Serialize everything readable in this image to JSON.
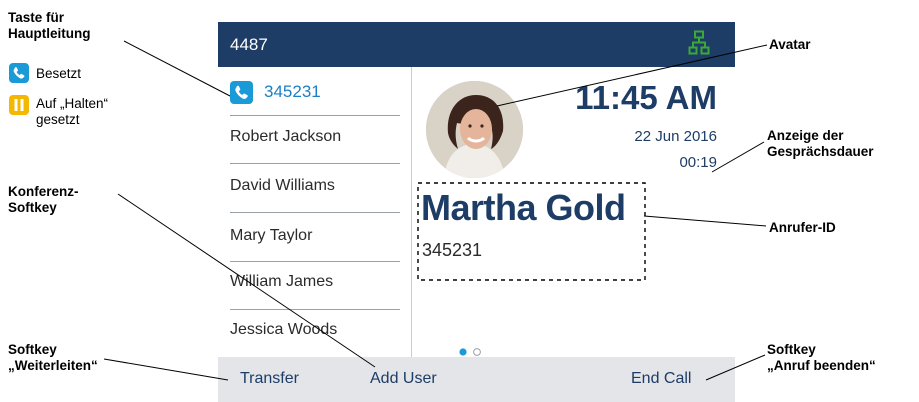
{
  "phone": {
    "extension": "4487",
    "line_key_label": "345231",
    "contacts": [
      "Robert Jackson",
      "David Williams",
      "Mary Taylor",
      "William James",
      "Jessica Woods"
    ],
    "time": "11:45 AM",
    "date": "22 Jun 2016",
    "call_duration": "00:19",
    "caller_name": "Martha Gold",
    "caller_number": "345231",
    "softkeys": {
      "transfer": "Transfer",
      "add_user": "Add User",
      "end_call": "End Call"
    },
    "pagination": {
      "pages": 2,
      "current": 1
    }
  },
  "annotations": {
    "line_key_1": "Taste für",
    "line_key_2": "Hauptleitung",
    "legend_busy": "Besetzt",
    "legend_hold_1": "Auf „Halten“",
    "legend_hold_2": "gesetzt",
    "conf_1": "Konferenz-",
    "conf_2": "Softkey",
    "fwd_1": "Softkey",
    "fwd_2": "„Weiterleiten“",
    "avatar": "Avatar",
    "dur_1": "Anzeige der",
    "dur_2": "Gesprächsdauer",
    "callerid": "Anrufer-ID",
    "end_1": "Softkey",
    "end_2": "„Anruf beenden“"
  },
  "colors": {
    "header_bg": "#1d3c66",
    "accent_blue": "#1a9bd8",
    "hold_yellow": "#f5b800",
    "network_green": "#3aa935",
    "softkey_bar": "#e3e5e8"
  },
  "icons": {
    "network": "network-icon",
    "line_key": "phone-handset-icon",
    "busy": "phone-handset-icon",
    "hold": "pause-icon"
  }
}
